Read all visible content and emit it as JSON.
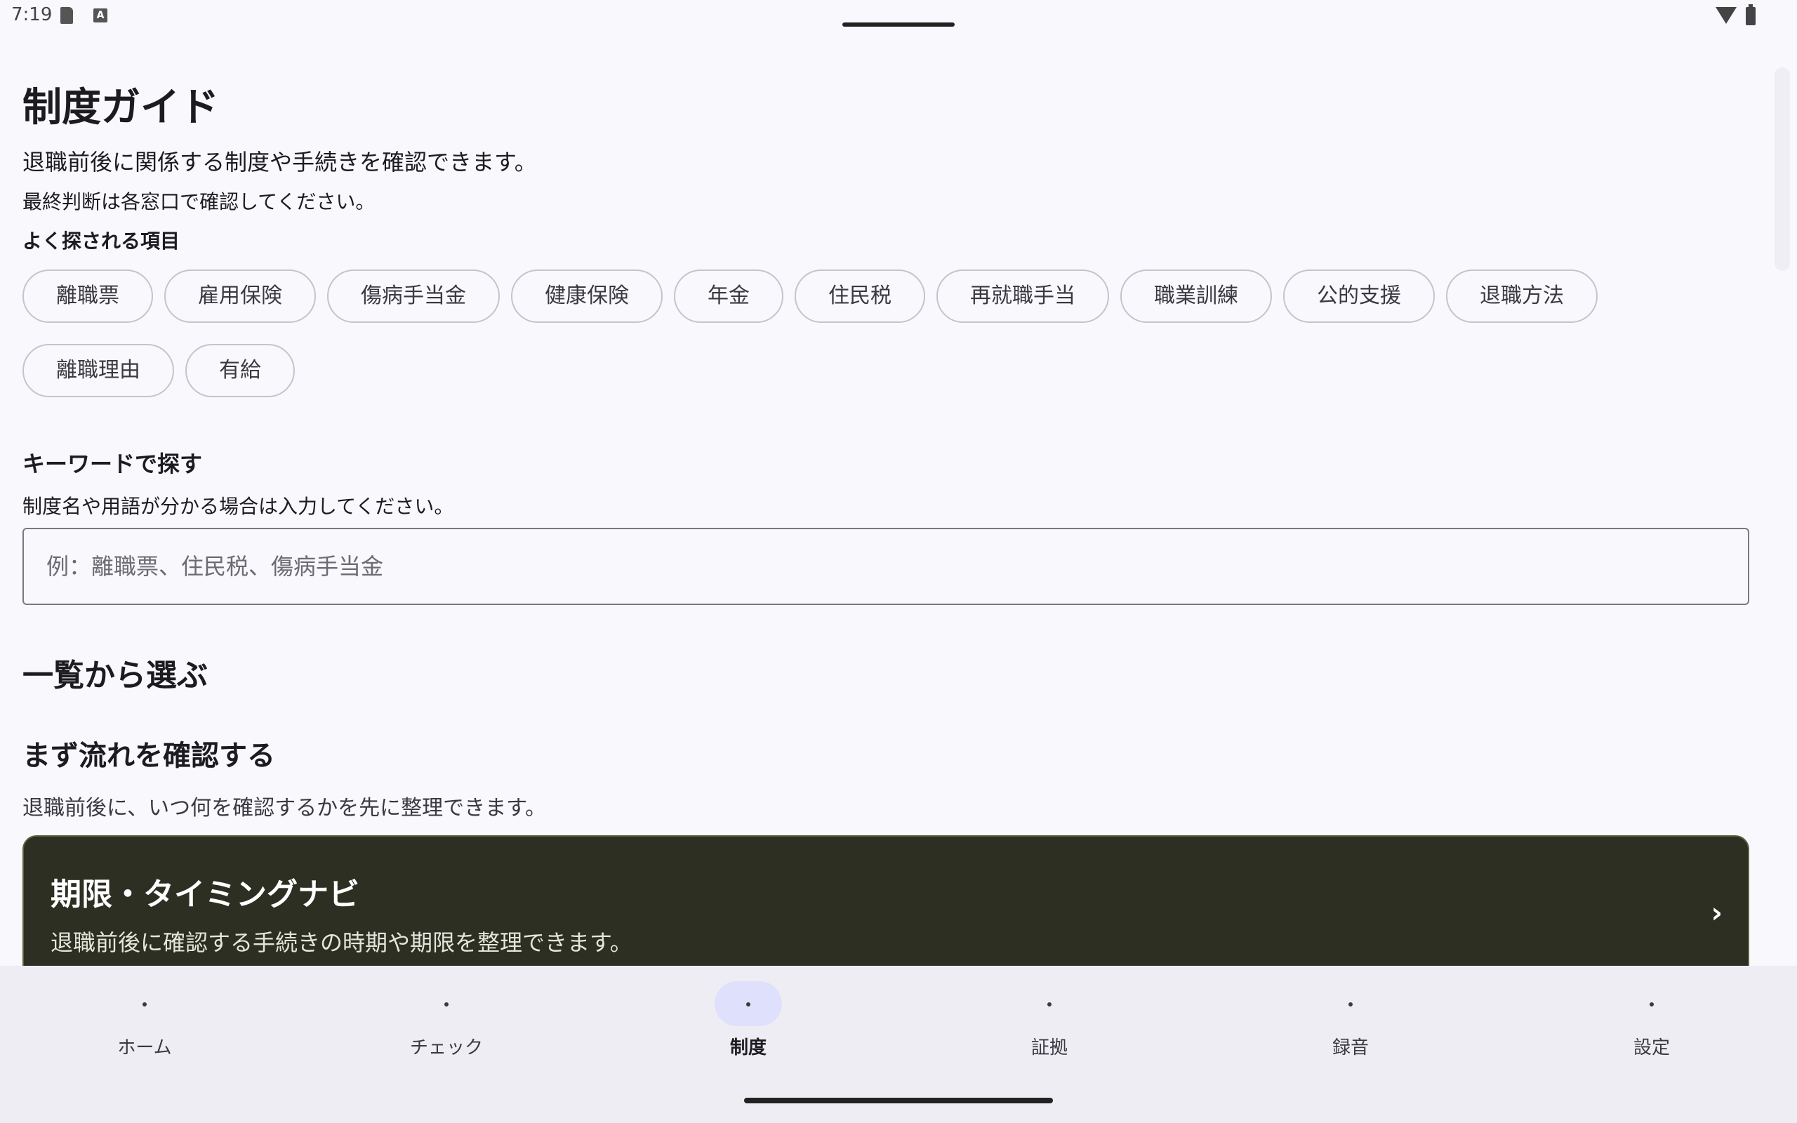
{
  "status_bar": {
    "time": "7:19"
  },
  "page": {
    "title": "制度ガイド",
    "description_1": "退職前後に関係する制度や手続きを確認できます。",
    "description_2": "最終判断は各窓口で確認してください。"
  },
  "popular": {
    "heading": "よく探される項目",
    "chips": [
      "離職票",
      "雇用保険",
      "傷病手当金",
      "健康保険",
      "年金",
      "住民税",
      "再就職手当",
      "職業訓練",
      "公的支援",
      "退職方法",
      "離職理由",
      "有給"
    ]
  },
  "keyword": {
    "heading": "キーワードで探す",
    "description": "制度名や用語が分かる場合は入力してください。",
    "placeholder": "例：離職票、住民税、傷病手当金",
    "value": ""
  },
  "list": {
    "heading": "一覧から選ぶ"
  },
  "flow": {
    "heading": "まず流れを確認する",
    "description": "退職前後に、いつ何を確認するかを先に整理できます。"
  },
  "timing_card": {
    "title": "期限・タイミングナビ",
    "description": "退職前後に確認する手続きの時期や期限を整理できます。",
    "chevron": "›"
  },
  "bottom_nav": {
    "active": "制度",
    "items": [
      {
        "label": "ホーム"
      },
      {
        "label": "チェック"
      },
      {
        "label": "制度"
      },
      {
        "label": "証拠"
      },
      {
        "label": "録音"
      },
      {
        "label": "設定"
      }
    ]
  },
  "colors": {
    "card_bg": "#2c2f21",
    "active_indicator": "#dfe0fb",
    "page_bg": "#f9f8fd"
  }
}
